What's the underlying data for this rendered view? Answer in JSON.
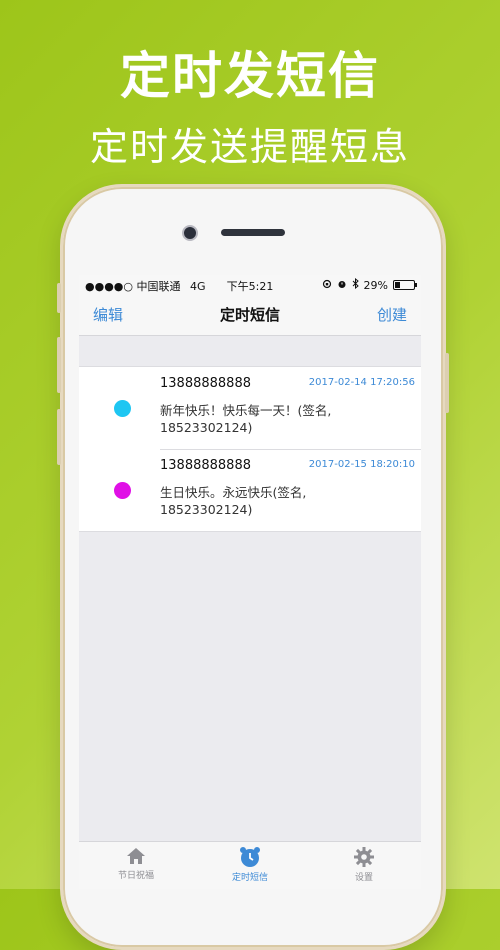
{
  "promo": {
    "headline": "定时发短信",
    "subheadline": "定时发送提醒短息"
  },
  "status_bar": {
    "carrier": "●●●●○ 中国联通",
    "network": "4G",
    "time": "下午5:21",
    "battery": "29%",
    "battery_level": 0.29,
    "icons": [
      "rotation-lock-icon",
      "alarm-icon",
      "bluetooth-icon"
    ]
  },
  "nav": {
    "left": "编辑",
    "title": "定时短信",
    "right": "创建"
  },
  "messages": [
    {
      "phone": "13888888888",
      "time": "2017-02-14 17:20:56",
      "text": "新年快乐！快乐每一天！(签名, 18523302124)",
      "color": "#1ec6f2"
    },
    {
      "phone": "13888888888",
      "time": "2017-02-15 18:20:10",
      "text": "生日快乐。永远快乐(签名, 18523302124)",
      "color": "#e010e6"
    }
  ],
  "tabs": [
    {
      "label": "节日祝福",
      "icon": "home-icon"
    },
    {
      "label": "定时短信",
      "icon": "alarm-clock-icon",
      "active": true
    },
    {
      "label": "设置",
      "icon": "gear-icon"
    }
  ],
  "colors": {
    "accent": "#3d8ad6",
    "background": "#a6cc1f"
  }
}
